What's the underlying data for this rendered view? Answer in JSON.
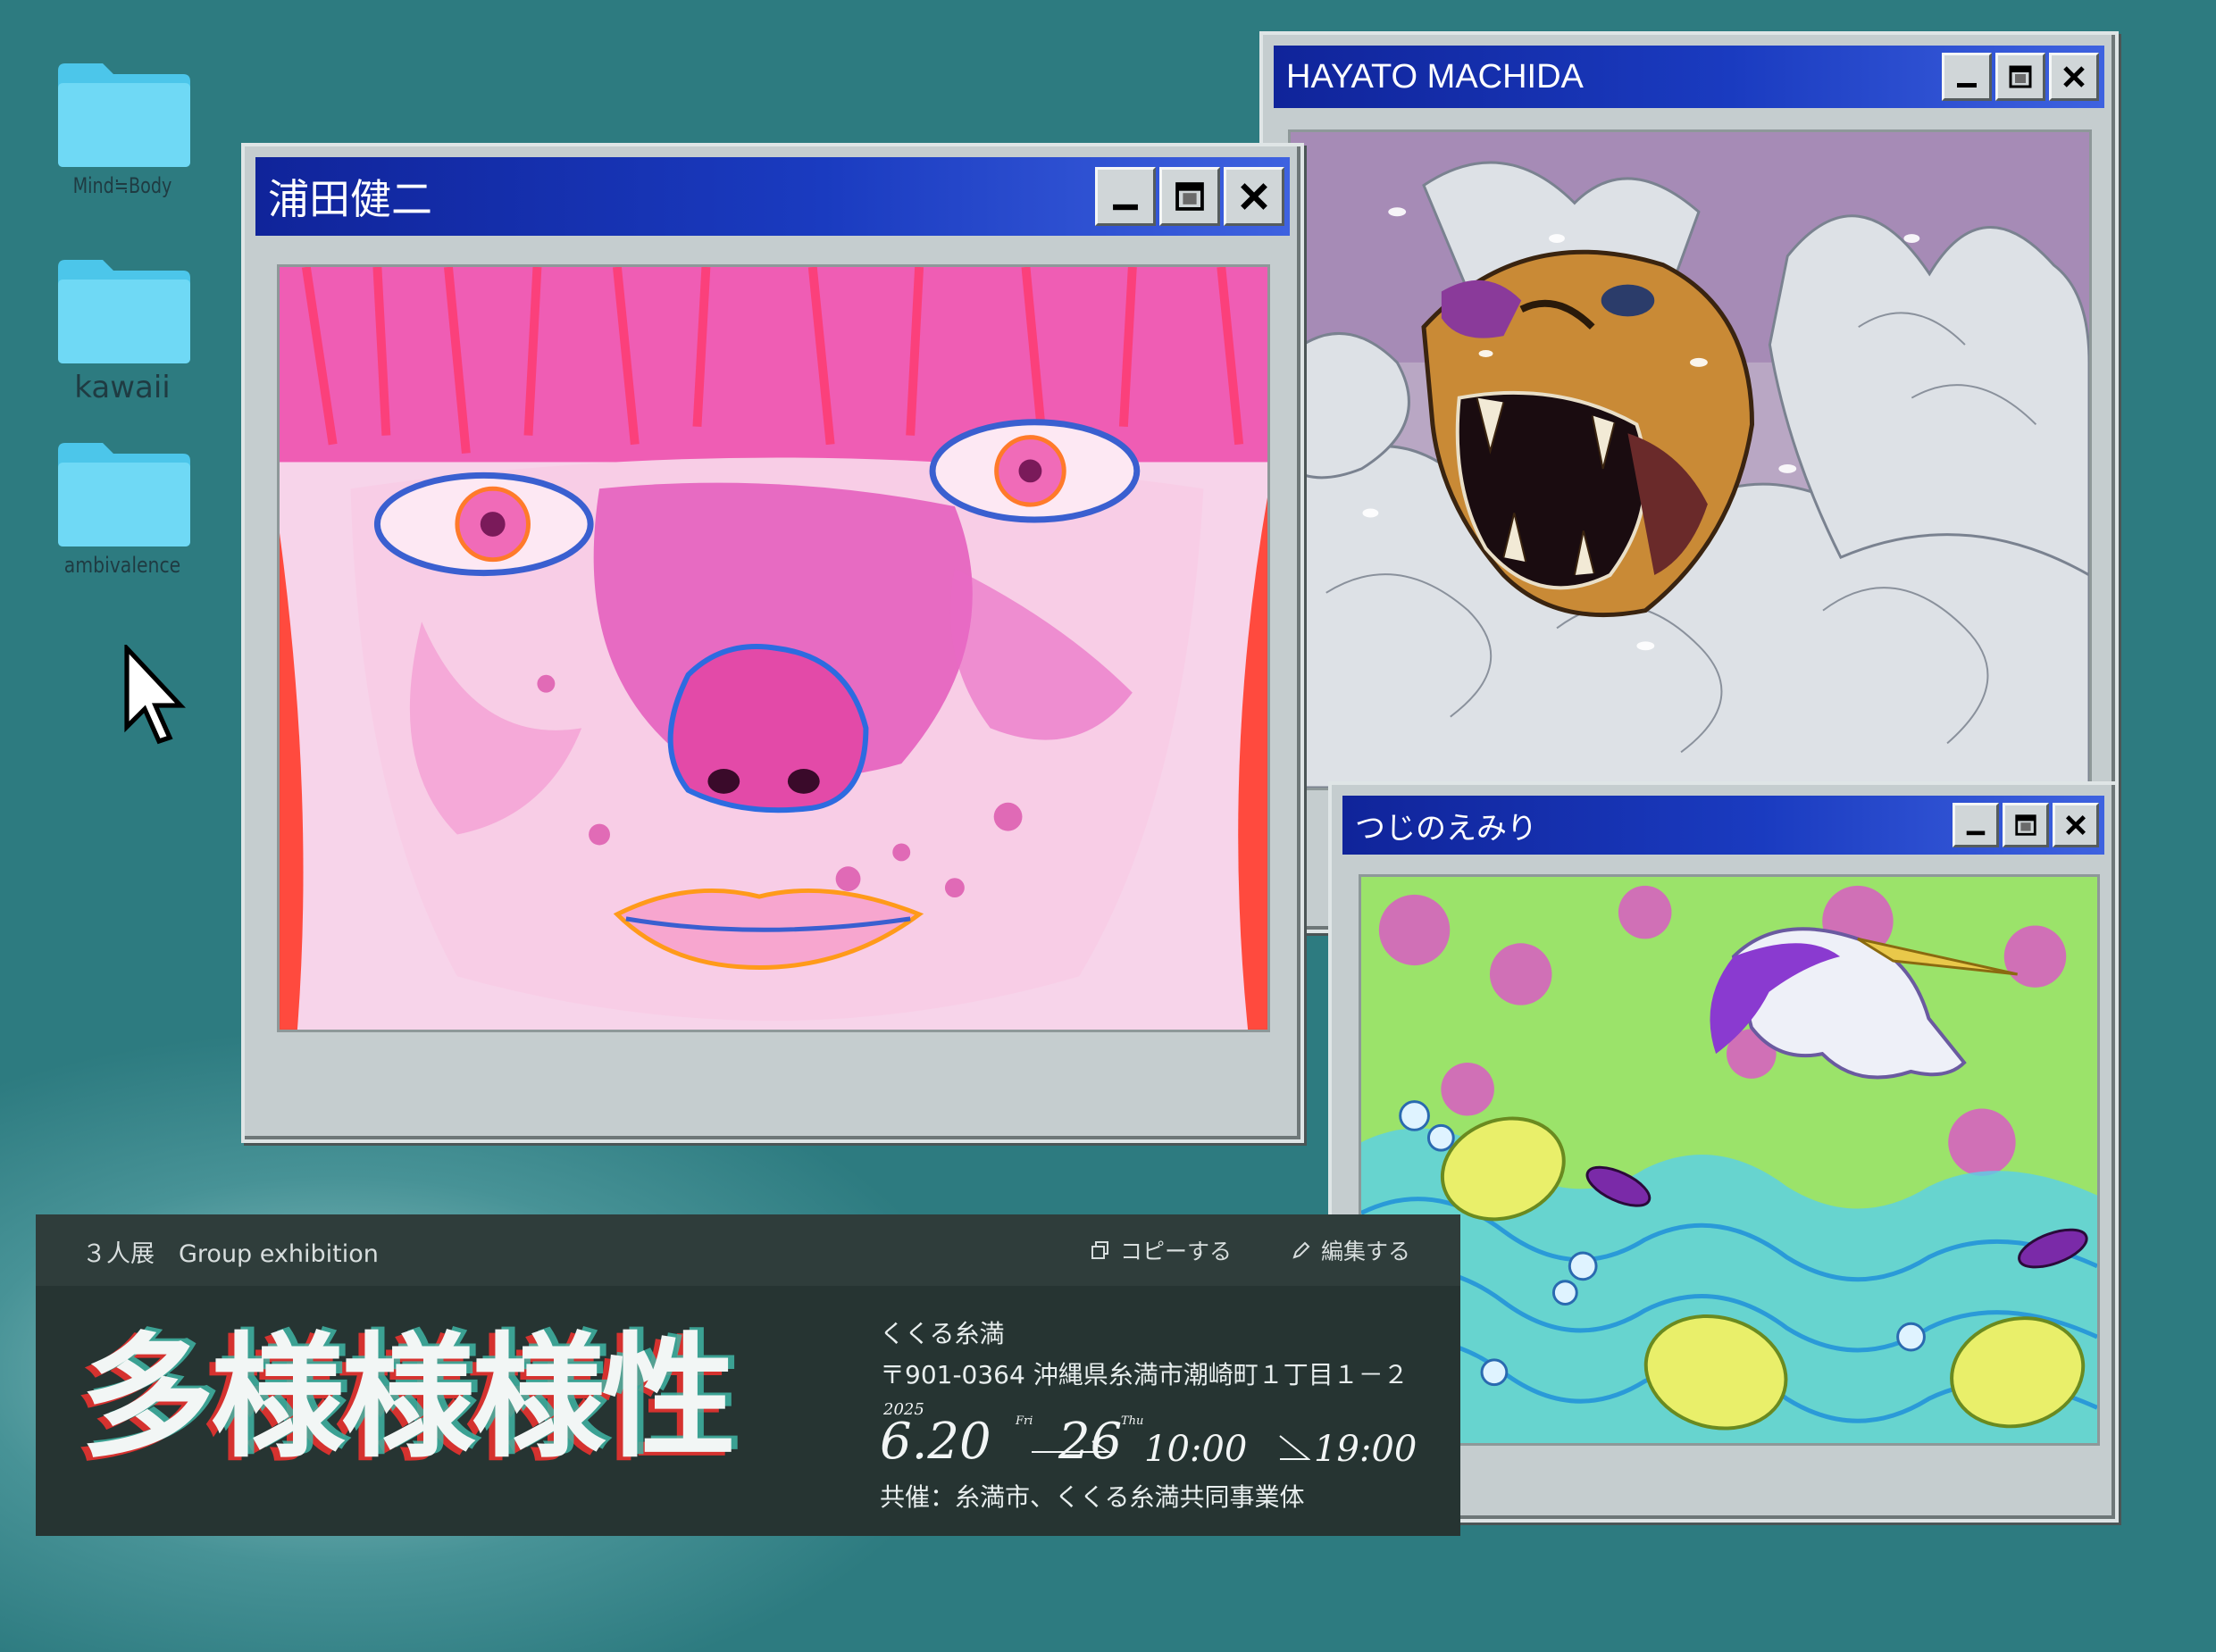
{
  "desktop": {
    "icons": [
      {
        "label": "Mind≒Body"
      },
      {
        "label": "kawaii"
      },
      {
        "label": "ambivalence"
      }
    ]
  },
  "windows": {
    "urata": {
      "title": "浦田健二"
    },
    "machida": {
      "title": "HAYATO MACHIDA"
    },
    "tsujino": {
      "title": "つじのえみり"
    }
  },
  "controls": {
    "minimize": "_",
    "maximize": "□",
    "close": "✕"
  },
  "panel": {
    "subtitle": "３人展　Group exhibition",
    "copy_label": "コピーする",
    "edit_label": "編集する",
    "exhibition_title": "多様様様性",
    "venue": "くくる糸満",
    "address": "〒901-0364 沖縄県糸満市潮崎町１丁目１－２",
    "year": "2025",
    "start_date": "6.20",
    "start_day": "Fri",
    "end_date": "26",
    "end_day": "Thu",
    "open_time": "10:00",
    "close_time": "19:00",
    "organizer": "共催：糸満市、くくる糸満共同事業体"
  },
  "colors": {
    "desktop": "#2d7b80",
    "titlebar": "#10249a",
    "window": "#c5cdcf",
    "panel": "#263432",
    "folder": "#5fd0ee"
  }
}
